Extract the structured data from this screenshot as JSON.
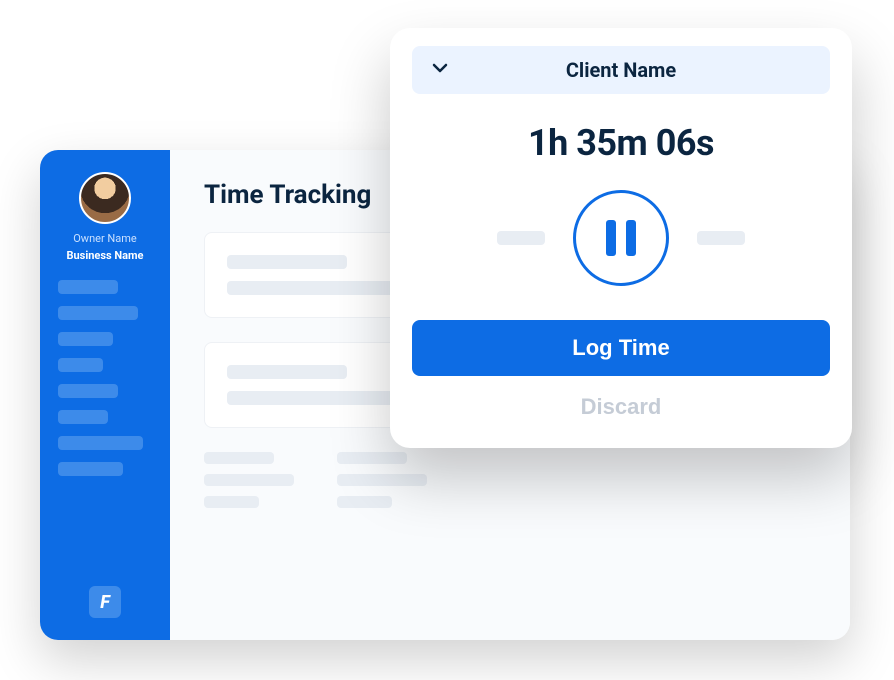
{
  "sidebar": {
    "owner_name": "Owner Name",
    "business_name": "Business Name",
    "logo_letter": "F"
  },
  "page": {
    "title": "Time Tracking"
  },
  "timer": {
    "client_label": "Client Name",
    "elapsed": "1h 35m 06s",
    "log_label": "Log Time",
    "discard_label": "Discard"
  }
}
